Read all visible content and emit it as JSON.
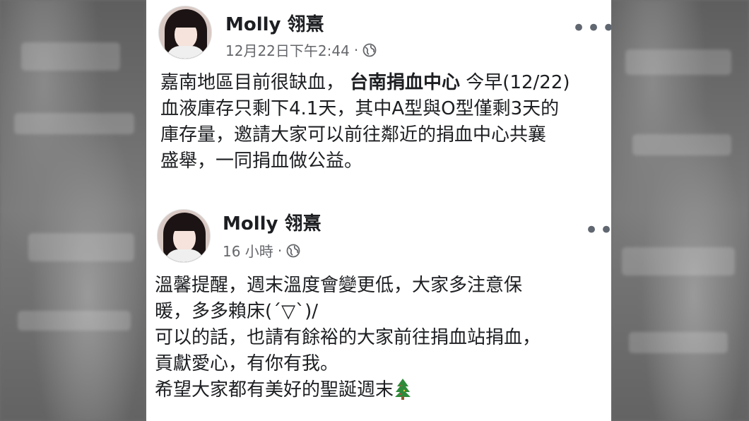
{
  "posts": [
    {
      "author": "Molly 翎熹",
      "timestamp": "12月22日下午2:44",
      "separator": "·",
      "privacy_icon": "globe-icon",
      "menu_icon": "more-options-icon",
      "body": {
        "line1_a": "嘉南地區目前很缺血，",
        "line1_tag": "台南捐血中心",
        "line1_b": " 今早(12/22)",
        "line2": "血液庫存只剩下4.1天，其中A型與O型僅剩3天的",
        "line3": "庫存量，邀請大家可以前往鄰近的捐血中心共襄",
        "line4": "盛舉，一同捐血做公益。"
      }
    },
    {
      "author": "Molly 翎熹",
      "timestamp": "16 小時",
      "separator": "·",
      "privacy_icon": "globe-icon",
      "menu_icon": "more-options-icon",
      "body": {
        "line1": "溫馨提醒，週末溫度會變更低，大家多注意保",
        "line2": "暖，多多賴床(´▽`)/",
        "line3": "可以的話，也請有餘裕的大家前往捐血站捐血，",
        "line4": "貢獻愛心，有你有我。",
        "line5": "希望大家都有美好的聖誕週末",
        "emoji": "christmas-tree-icon"
      }
    }
  ],
  "colors": {
    "text": "#1c1e21",
    "secondary": "#65676b",
    "panel_bg": "#ffffff",
    "backdrop": "#6e6e6e",
    "tree": "#2e8b3a"
  }
}
